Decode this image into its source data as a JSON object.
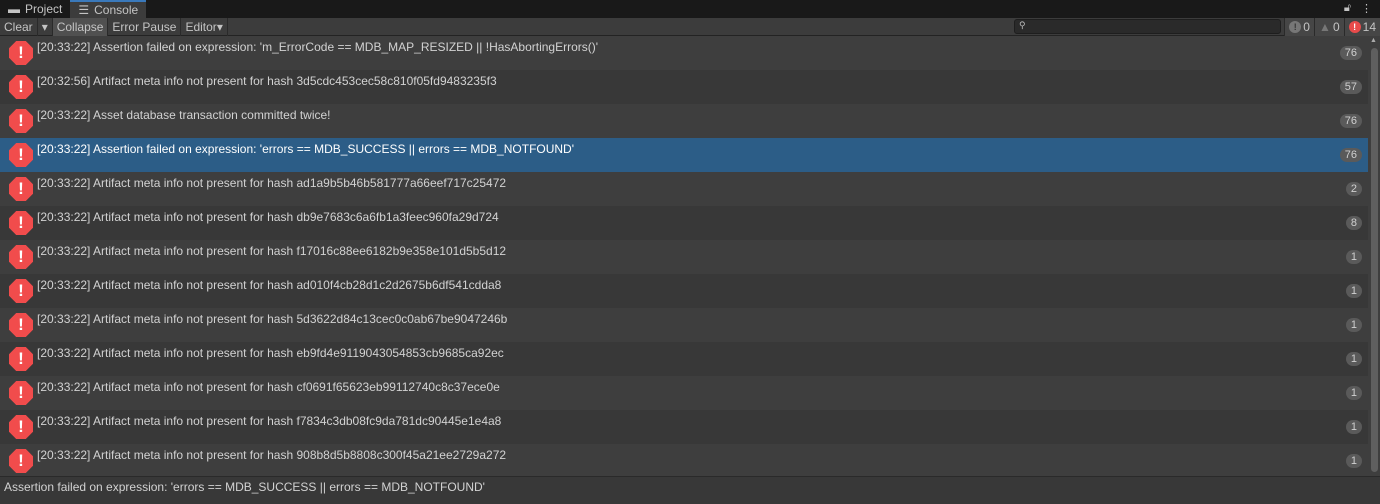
{
  "tabs": [
    {
      "label": "Project",
      "icon": "folder-icon"
    },
    {
      "label": "Console",
      "icon": "console-icon"
    }
  ],
  "toolbar": {
    "clear": "Clear",
    "collapse": "Collapse",
    "error_pause": "Error Pause",
    "editor": "Editor",
    "search_placeholder": ""
  },
  "counts": {
    "info": "0",
    "warnings": "0",
    "errors": "14"
  },
  "entries": [
    {
      "text": "[20:33:22] Assertion failed on expression: 'm_ErrorCode == MDB_MAP_RESIZED || !HasAbortingErrors()'",
      "count": "76"
    },
    {
      "text": "[20:32:56] Artifact meta info not present for hash 3d5cdc453cec58c810f05fd9483235f3",
      "count": "57"
    },
    {
      "text": "[20:33:22] Asset database transaction committed twice!",
      "count": "76"
    },
    {
      "text": "[20:33:22] Assertion failed on expression: 'errors == MDB_SUCCESS || errors == MDB_NOTFOUND'",
      "count": "76",
      "selected": true
    },
    {
      "text": "[20:33:22] Artifact meta info not present for hash ad1a9b5b46b581777a66eef717c25472",
      "count": "2"
    },
    {
      "text": "[20:33:22] Artifact meta info not present for hash db9e7683c6a6fb1a3feec960fa29d724",
      "count": "8"
    },
    {
      "text": "[20:33:22] Artifact meta info not present for hash f17016c88ee6182b9e358e101d5b5d12",
      "count": "1"
    },
    {
      "text": "[20:33:22] Artifact meta info not present for hash ad010f4cb28d1c2d2675b6df541cdda8",
      "count": "1"
    },
    {
      "text": "[20:33:22] Artifact meta info not present for hash 5d3622d84c13cec0c0ab67be9047246b",
      "count": "1"
    },
    {
      "text": "[20:33:22] Artifact meta info not present for hash eb9fd4e9119043054853cb9685ca92ec",
      "count": "1"
    },
    {
      "text": "[20:33:22] Artifact meta info not present for hash cf0691f65623eb99112740c8c37ece0e",
      "count": "1"
    },
    {
      "text": "[20:33:22] Artifact meta info not present for hash f7834c3db08fc9da781dc90445e1e4a8",
      "count": "1"
    },
    {
      "text": "[20:33:22] Artifact meta info not present for hash 908b8d5b8808c300f45a21ee2729a272",
      "count": "1"
    }
  ],
  "status": "Assertion failed on expression: 'errors == MDB_SUCCESS || errors == MDB_NOTFOUND'"
}
